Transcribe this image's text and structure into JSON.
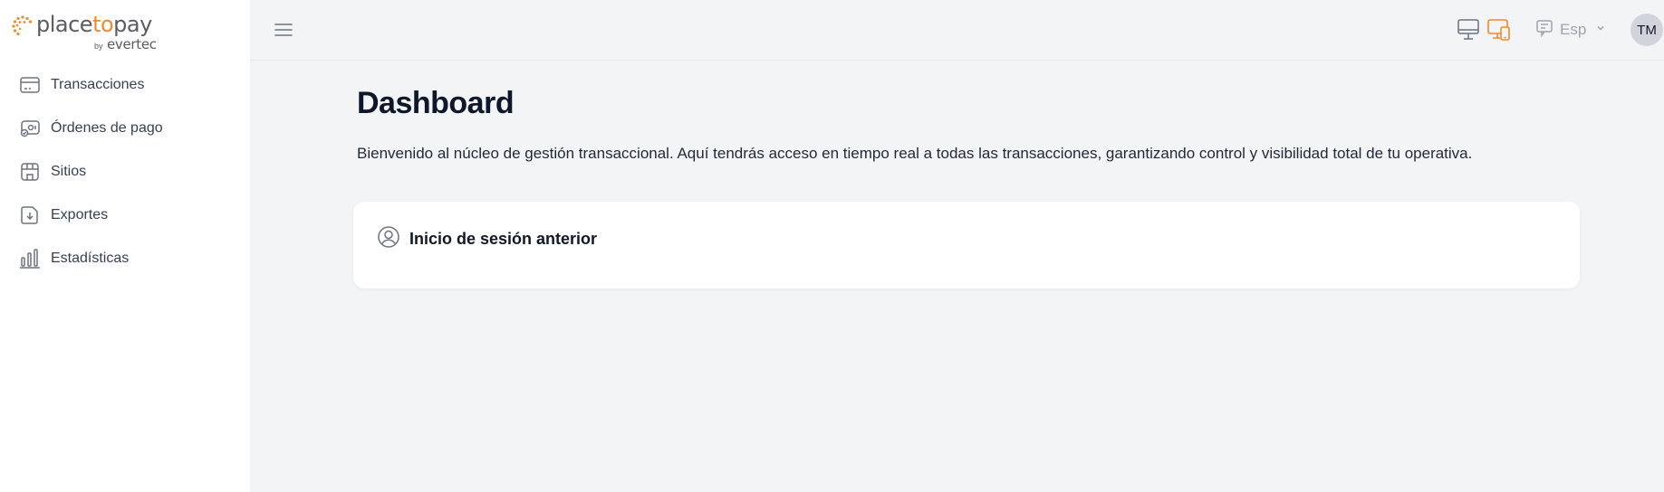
{
  "brand": {
    "name_part1": "place",
    "name_part2": "to",
    "name_part3": "pay",
    "by": "by",
    "company": "evertec",
    "accent_color": "#f18a29"
  },
  "sidebar": {
    "items": [
      {
        "label": "Transacciones",
        "icon": "card-icon"
      },
      {
        "label": "Órdenes de pago",
        "icon": "payment-order-icon"
      },
      {
        "label": "Sitios",
        "icon": "store-icon"
      },
      {
        "label": "Exportes",
        "icon": "export-icon"
      },
      {
        "label": "Estadísticas",
        "icon": "bar-chart-icon"
      }
    ]
  },
  "topbar": {
    "menu_icon": "hamburger-icon",
    "language": "Esp",
    "avatar_initials": "TM"
  },
  "main": {
    "title": "Dashboard",
    "description": "Bienvenido al núcleo de gestión transaccional. Aquí tendrás acceso en tiempo real a todas las transacciones, garantizando control y visibilidad total de tu operativa.",
    "card": {
      "title": "Inicio de sesión anterior",
      "icon": "user-circle-icon"
    }
  }
}
